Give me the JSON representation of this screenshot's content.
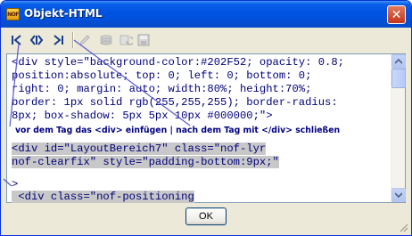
{
  "window": {
    "title": "Objekt-HTML",
    "app_icon_text": "NOF",
    "close_glyph": "✕"
  },
  "toolbar": {
    "buttons": [
      {
        "icon": "goto-start-icon",
        "enabled": true
      },
      {
        "icon": "expand-icon",
        "enabled": true
      },
      {
        "icon": "goto-end-icon",
        "enabled": true
      },
      {
        "icon": "edit-icon",
        "enabled": false
      },
      {
        "icon": "stack-icon",
        "enabled": false
      },
      {
        "icon": "refresh-icon",
        "enabled": false
      },
      {
        "icon": "save-icon",
        "enabled": false
      }
    ]
  },
  "editor": {
    "code_block_1": "<div style=\"background-color:#202F52; opacity: 0.8;\nposition:absolute; top: 0; left: 0; bottom: 0;\nright: 0; margin: auto; width:80%; height:70%;\nborder: 1px solid rgb(255,255,255); border-radius:\n8px; box-shadow: 5px 5px 10px #000000;\">",
    "hint": "vor dem Tag das <div> einfügen | nach dem Tag mit </div> schließen",
    "code_block_2_line1": "<div id=\"LayoutBereich7\" class=\"nof-lyr",
    "code_block_2_line2": "nof-clearfix\" style=\"padding-bottom:9px;\"",
    "code_block_3": ">",
    "code_block_4": " <div class=\"nof-positioning"
  },
  "footer": {
    "ok_label": "OK"
  },
  "colors": {
    "titlebar": "#0054e3",
    "dialog_bg": "#ece9d8",
    "code_text": "#00007a",
    "hint_text": "#000080",
    "selection": "#c8c8c8",
    "arrow": "#5a5acd"
  }
}
